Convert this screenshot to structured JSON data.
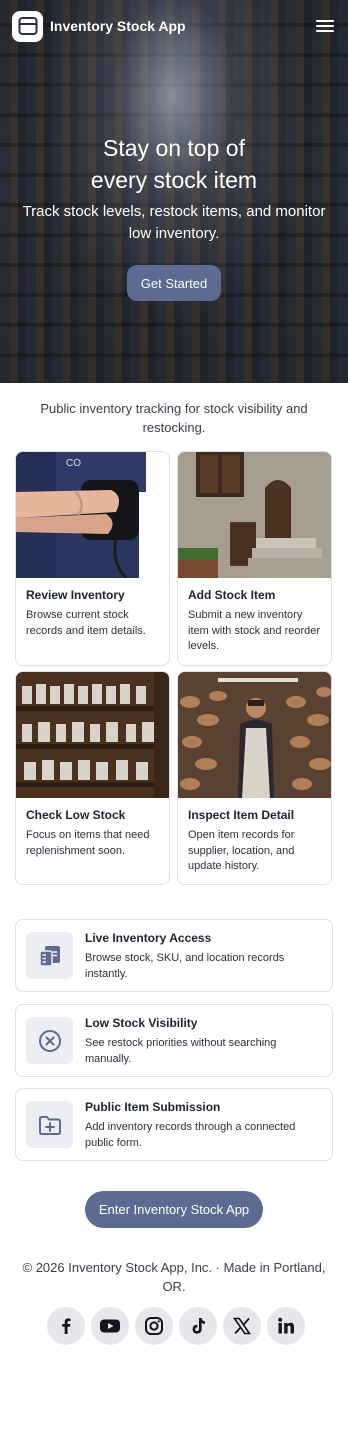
{
  "header": {
    "app_name": "Inventory Stock App",
    "logo_icon": "box-icon",
    "menu_icon": "hamburger-menu-icon"
  },
  "hero": {
    "title_line1": "Stay on top of",
    "title_line2": "every stock item",
    "subtitle": "Track stock levels, restock items, and monitor low inventory.",
    "cta_label": "Get Started"
  },
  "intro": "Public inventory tracking for stock visibility and restocking.",
  "cards": [
    {
      "title": "Review Inventory",
      "description": "Browse current stock records and item details."
    },
    {
      "title": "Add Stock Item",
      "description": "Submit a new inventory item with stock and reorder levels."
    },
    {
      "title": "Check Low Stock",
      "description": "Focus on items that need replenishment soon."
    },
    {
      "title": "Inspect Item Detail",
      "description": "Open item records for supplier, location, and update history."
    }
  ],
  "features": [
    {
      "title": "Live Inventory Access",
      "description": "Browse stock, SKU, and location records instantly.",
      "icon": "records-list-icon"
    },
    {
      "title": "Low Stock Visibility",
      "description": "See restock priorities without searching manually.",
      "icon": "circle-x-icon"
    },
    {
      "title": "Public Item Submission",
      "description": "Add inventory records through a connected public form.",
      "icon": "folder-plus-icon"
    }
  ],
  "enter_button": "Enter Inventory Stock App",
  "footer": "© 2026 Inventory Stock App, Inc. · Made in Portland, OR.",
  "socials": [
    "facebook-icon",
    "youtube-icon",
    "instagram-icon",
    "tiktok-icon",
    "x-icon",
    "linkedin-icon"
  ],
  "colors": {
    "accent": "#5d6b92",
    "icon_bg": "#eceef3",
    "border": "#dcdfe6"
  }
}
